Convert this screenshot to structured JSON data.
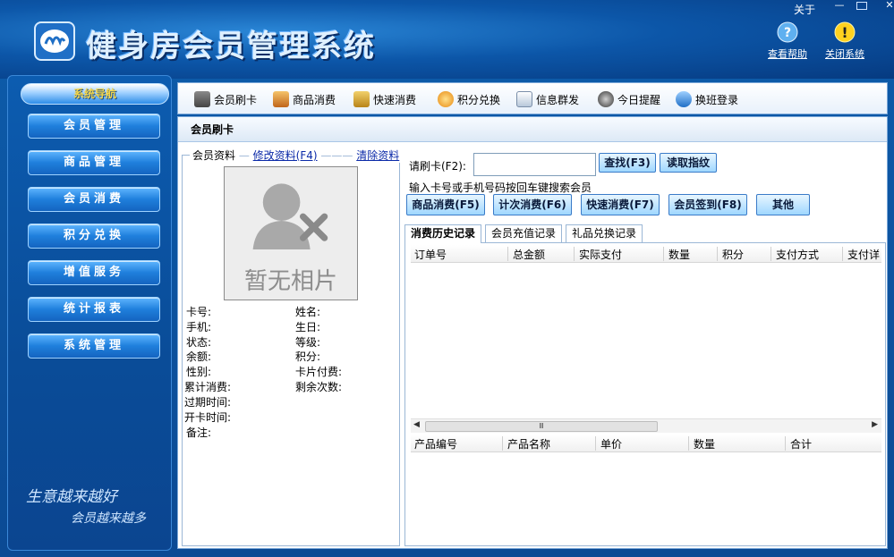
{
  "app": {
    "title": "健身房会员管理系统",
    "about": "关于",
    "help_label": "查看帮助",
    "exit_label": "关闭系统"
  },
  "sidebar": {
    "title": "系统导航",
    "items": [
      "会员管理",
      "商品管理",
      "会员消费",
      "积分兑换",
      "增值服务",
      "统计报表",
      "系统管理"
    ],
    "slogan1": "生意越来越好",
    "slogan2": "会员越来越多"
  },
  "toolbar": {
    "items": [
      "会员刷卡",
      "商品消费",
      "快速消费",
      "积分兑换",
      "信息群发",
      "今日提醒",
      "换班登录"
    ]
  },
  "main": {
    "title": "会员刷卡",
    "member_info": {
      "legend": "会员资料",
      "edit_link": "修改资料(F4)",
      "clear_link": "清除资料",
      "photo_text": "暂无相片",
      "fields_left": [
        "卡号:",
        "手机:",
        "状态:",
        "余额:",
        "性别:",
        "累计消费:",
        "过期时间:",
        "开卡时间:",
        "备注:"
      ],
      "fields_right": [
        "姓名:",
        "生日:",
        "等级:",
        "积分:",
        "卡片付费:",
        "剩余次数:"
      ]
    },
    "swipe": {
      "label": "请刷卡(F2):",
      "value": "",
      "search_button": "查找(F3)",
      "fingerprint_button": "读取指纹",
      "hint": "输入卡号或手机号码按回车键搜索会员"
    },
    "actions": [
      "商品消费(F5)",
      "计次消费(F6)",
      "快速消费(F7)",
      "会员签到(F8)",
      "其他"
    ],
    "tabs": [
      "消费历史记录",
      "会员充值记录",
      "礼品兑换记录"
    ],
    "history_columns": [
      "订单号",
      "总金额",
      "实际支付",
      "数量",
      "积分",
      "支付方式",
      "支付详"
    ],
    "product_columns": [
      "产品编号",
      "产品名称",
      "单价",
      "数量",
      "合计"
    ],
    "scroll_thumb": "Ⅲ"
  },
  "colors": {
    "header_bg": "#0c56a8",
    "nav_button": "#1f7fdc",
    "action_button": "#9fd7ff",
    "link": "#0b2aa8"
  }
}
